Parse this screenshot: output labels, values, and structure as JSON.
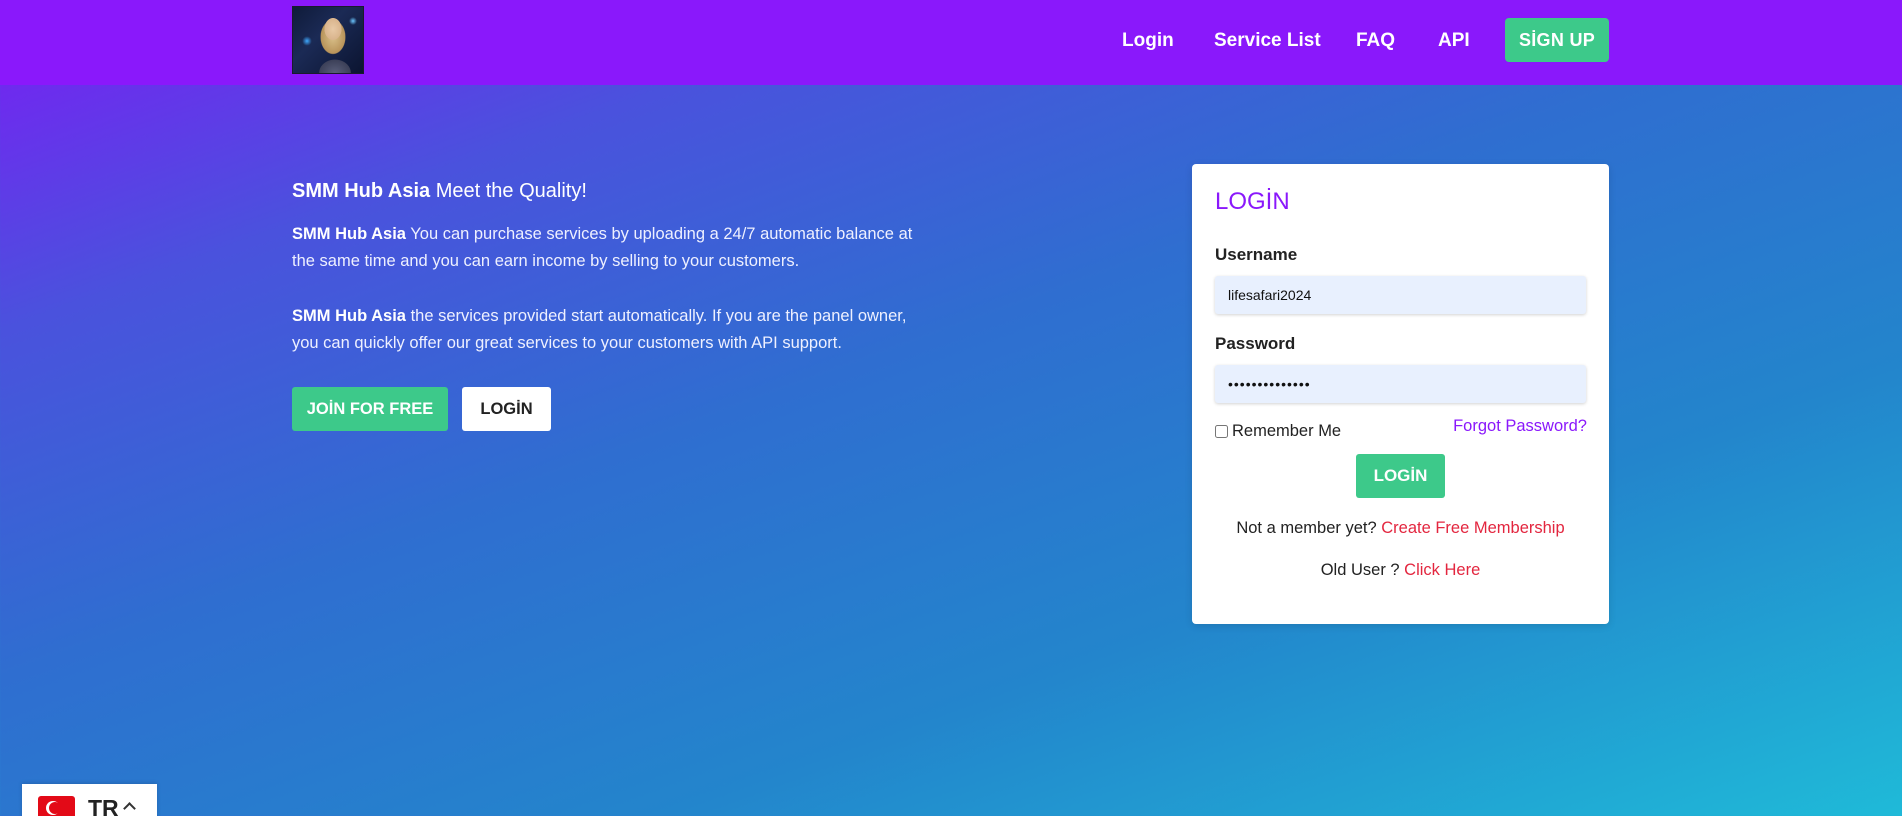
{
  "header": {
    "nav": {
      "login": "Login",
      "services": "Service List",
      "faq": "FAQ",
      "api": "API"
    },
    "signup_label": "SİGN UP"
  },
  "hero": {
    "title_brand": "SMM Hub Asia",
    "title_rest": " Meet the Quality!",
    "p1_brand": "SMM Hub Asia",
    "p1_text": " You can purchase services by uploading a 24/7 automatic balance at the same time and you can earn income by selling to your customers.",
    "p2_brand": "SMM Hub Asia",
    "p2_text": " the services provided start automatically. If you are the panel owner, you can quickly offer our great services to your customers with API support.",
    "join_label": "JOİN FOR FREE",
    "login_label": "LOGİN"
  },
  "login_card": {
    "title": "LOGİN",
    "username_label": "Username",
    "username_value": "lifesafari2024",
    "password_label": "Password",
    "password_value": "••••••••••••••",
    "remember_label": "Remember Me",
    "forgot_label": "Forgot Password?",
    "submit_label": "LOGİN",
    "not_member_text": "Not a member yet? ",
    "create_link": "Create Free Membership",
    "old_user_text": "Old User ? ",
    "click_here_link": "Click Here"
  },
  "language": {
    "code": "TR",
    "flag_icon": "turkey-flag-icon"
  },
  "colors": {
    "header_bg": "#8a18fb",
    "accent_green": "#3dc98a",
    "link_red": "#e3263f",
    "title_purple": "#8a18fb"
  }
}
